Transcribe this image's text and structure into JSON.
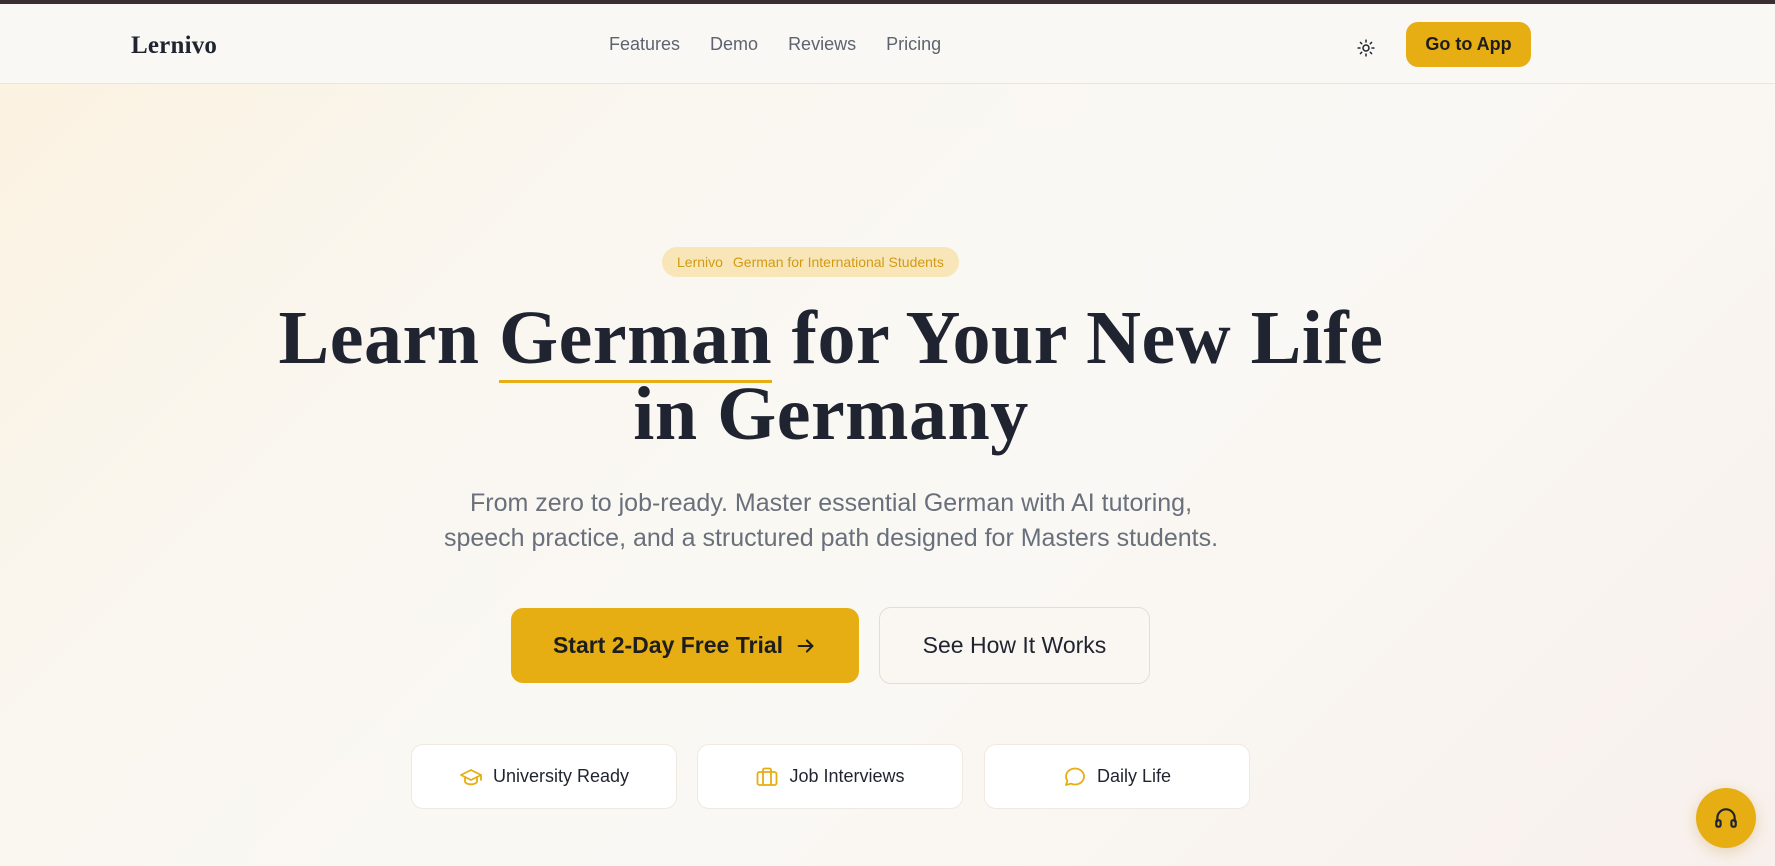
{
  "header": {
    "logo": "Lernivo",
    "nav": [
      "Features",
      "Demo",
      "Reviews",
      "Pricing"
    ],
    "cta_label": "Go to App",
    "theme_icon": "sun-icon"
  },
  "hero": {
    "badge_brand": "Lernivo",
    "badge_text": "German for International Students",
    "title_part1": "Learn ",
    "title_highlight": "German",
    "title_part2": " for Your New Life",
    "title_line2": "in Germany",
    "subtitle_line1": "From zero to job-ready. Master essential German with AI tutoring,",
    "subtitle_line2": "speech practice, and a structured path designed for Masters students.",
    "primary_cta": "Start 2-Day Free Trial",
    "secondary_cta": "See How It Works",
    "pills": [
      {
        "label": "University Ready",
        "icon": "graduation-cap-icon"
      },
      {
        "label": "Job Interviews",
        "icon": "briefcase-icon"
      },
      {
        "label": "Daily Life",
        "icon": "chat-bubble-icon"
      }
    ]
  },
  "support": {
    "icon": "headphones-icon"
  },
  "colors": {
    "accent": "#e6ae12",
    "text_dark": "#1f2430",
    "text_muted": "#69707b",
    "background": "#faf8f4"
  }
}
